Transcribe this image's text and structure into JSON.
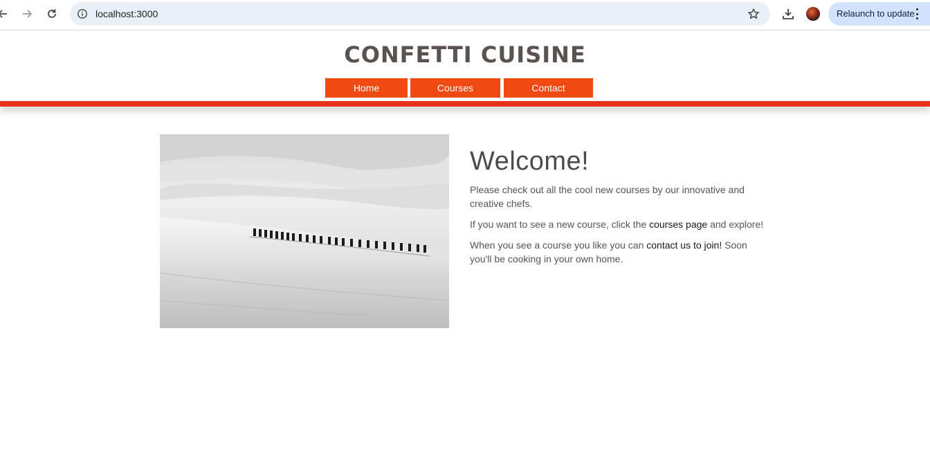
{
  "browser": {
    "url": "localhost:3000",
    "relaunch_label": "Relaunch to update",
    "icons": {
      "back": "back-arrow-icon",
      "forward": "forward-arrow-icon",
      "reload": "reload-icon",
      "site_info": "info-icon",
      "bookmark": "star-icon",
      "download": "download-icon",
      "menu": "more-vert-icon"
    },
    "colors": {
      "omnibox_bg": "#eaf0f8",
      "relaunch_bg": "#d3e3fd"
    }
  },
  "site": {
    "title": "CONFETTI CUISINE",
    "nav": [
      {
        "label": "Home"
      },
      {
        "label": "Courses"
      },
      {
        "label": "Contact"
      }
    ],
    "colors": {
      "accent": "#f04a12",
      "bar": "#e8321a",
      "title": "#5a524e"
    }
  },
  "main": {
    "image_description": "",
    "heading": "Welcome!",
    "p1": "Please check out all the cool new courses by our innovative and creative chefs.",
    "p2_before": "If you want to see a new course, click the ",
    "p2_link": "courses page",
    "p2_after": " and explore!",
    "p3_before": "When you see a course you like you can ",
    "p3_link": "contact us to join!",
    "p3_after": " Soon you'll be cooking in your own home."
  }
}
